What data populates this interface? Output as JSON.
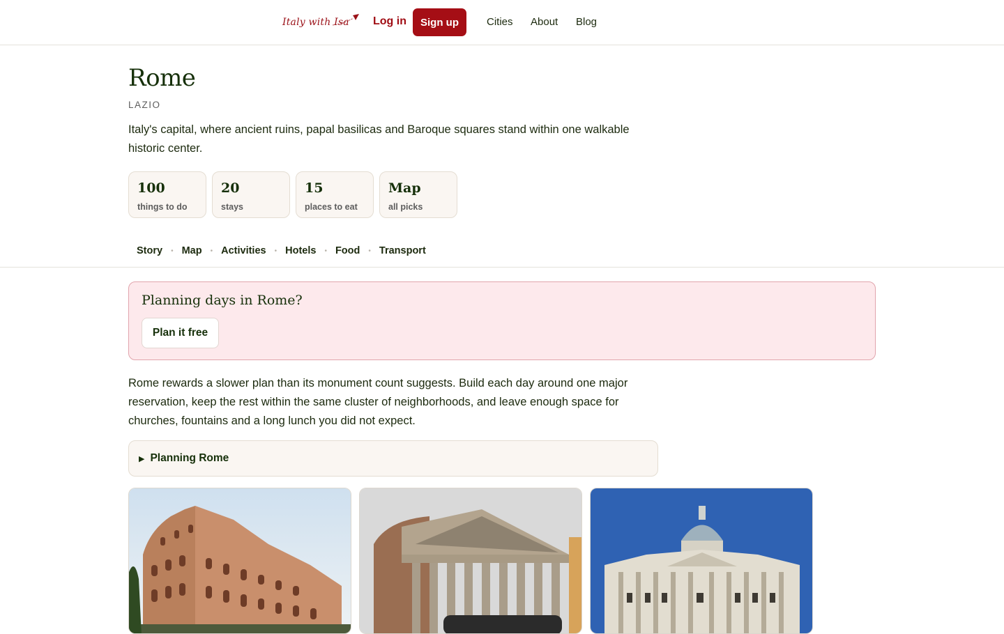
{
  "header": {
    "logo_text": "Italy with Isa",
    "login_label": "Log in",
    "signup_label": "Sign up",
    "nav": [
      "Cities",
      "About",
      "Blog"
    ]
  },
  "city": {
    "name": "Rome",
    "region": "LAZIO",
    "lede": "Italy's capital, where ancient ruins, papal basilicas and Baroque squares stand within one walkable historic center."
  },
  "stats": [
    {
      "value": "100",
      "label": "things to do"
    },
    {
      "value": "20",
      "label": "stays"
    },
    {
      "value": "15",
      "label": "places to eat"
    },
    {
      "value": "Map",
      "label": "all picks"
    }
  ],
  "tabs": [
    "Story",
    "Map",
    "Activities",
    "Hotels",
    "Food",
    "Transport"
  ],
  "banner": {
    "title": "Planning days in Rome?",
    "button_label": "Plan it free"
  },
  "story": "Rome rewards a slower plan than its monument count suggests. Build each day around one major reservation, keep the rest within the same cluster of neighborhoods, and leave enough space for churches, fountains and a long lunch you did not expect.",
  "details_label": "Planning Rome",
  "colors": {
    "brand": "#a50e15",
    "heading": "#16300a",
    "banner_bg": "#fde9ec",
    "banner_border": "#e1a4ac"
  },
  "photos": [
    {
      "subject": "colosseum"
    },
    {
      "subject": "pantheon"
    },
    {
      "subject": "st-peters-basilica"
    }
  ]
}
